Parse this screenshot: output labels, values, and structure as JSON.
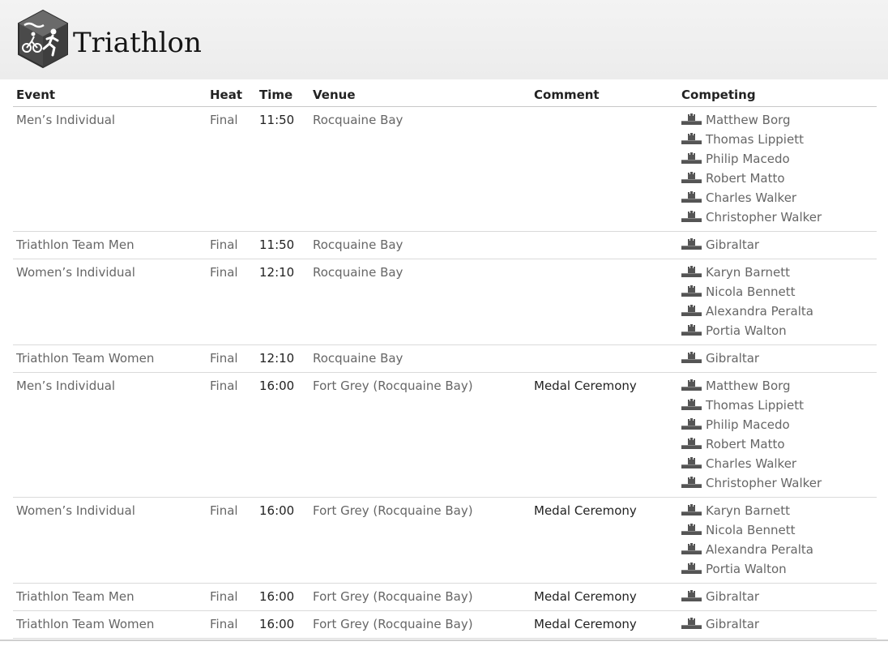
{
  "header": {
    "title": "Triathlon",
    "logo_icon": "triathlon-logo-icon"
  },
  "table": {
    "columns": [
      "Event",
      "Heat",
      "Time",
      "Venue",
      "Comment",
      "Competing"
    ],
    "rows": [
      {
        "event": "Men’s Individual",
        "heat": "Final",
        "time": "11:50",
        "venue": "Rocquaine Bay",
        "comment": "",
        "competing": [
          "Matthew Borg",
          "Thomas Lippiett",
          "Philip Macedo",
          "Robert Matto",
          "Charles Walker",
          "Christopher Walker"
        ]
      },
      {
        "event": "Triathlon Team Men",
        "heat": "Final",
        "time": "11:50",
        "venue": "Rocquaine Bay",
        "comment": "",
        "competing": [
          "Gibraltar"
        ]
      },
      {
        "event": "Women’s Individual",
        "heat": "Final",
        "time": "12:10",
        "venue": "Rocquaine Bay",
        "comment": "",
        "competing": [
          "Karyn Barnett",
          "Nicola Bennett",
          "Alexandra Peralta",
          "Portia Walton"
        ]
      },
      {
        "event": "Triathlon Team Women",
        "heat": "Final",
        "time": "12:10",
        "venue": "Rocquaine Bay",
        "comment": "",
        "competing": [
          "Gibraltar"
        ]
      },
      {
        "event": "Men’s Individual",
        "heat": "Final",
        "time": "16:00",
        "venue": "Fort Grey (Rocquaine Bay)",
        "comment": "Medal Ceremony",
        "competing": [
          "Matthew Borg",
          "Thomas Lippiett",
          "Philip Macedo",
          "Robert Matto",
          "Charles Walker",
          "Christopher Walker"
        ]
      },
      {
        "event": "Women’s Individual",
        "heat": "Final",
        "time": "16:00",
        "venue": "Fort Grey (Rocquaine Bay)",
        "comment": "Medal Ceremony",
        "competing": [
          "Karyn Barnett",
          "Nicola Bennett",
          "Alexandra Peralta",
          "Portia Walton"
        ]
      },
      {
        "event": "Triathlon Team Men",
        "heat": "Final",
        "time": "16:00",
        "venue": "Fort Grey (Rocquaine Bay)",
        "comment": "Medal Ceremony",
        "competing": [
          "Gibraltar"
        ]
      },
      {
        "event": "Triathlon Team Women",
        "heat": "Final",
        "time": "16:00",
        "venue": "Fort Grey (Rocquaine Bay)",
        "comment": "Medal Ceremony",
        "competing": [
          "Gibraltar"
        ]
      }
    ],
    "flag_icon": "gibraltar-flag-icon"
  }
}
